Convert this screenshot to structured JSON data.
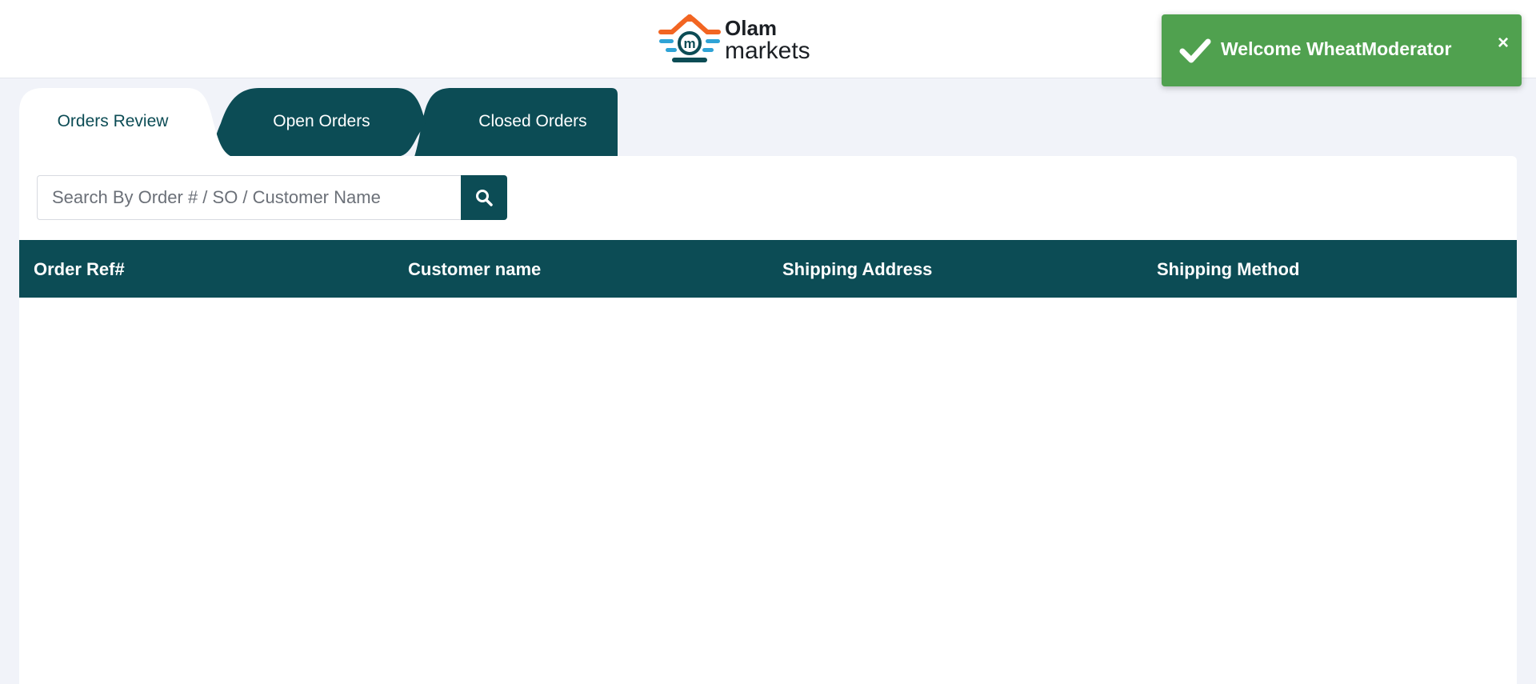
{
  "brand": {
    "name_line1": "Olam",
    "name_line2": "markets",
    "logo_letter": "m",
    "colors": {
      "orange": "#f26522",
      "blue": "#2fa3d6",
      "teal": "#0c4c55"
    }
  },
  "toast": {
    "message": "Welcome WheatModerator",
    "close_label": "×",
    "color": "#50a14f",
    "icon": "check-icon"
  },
  "tabs": [
    {
      "label": "Orders Review",
      "active": true
    },
    {
      "label": "Open Orders",
      "active": false
    },
    {
      "label": "Closed Orders",
      "active": false
    }
  ],
  "search": {
    "value": "",
    "placeholder": "Search By Order # / SO / Customer Name",
    "button_icon": "search-icon"
  },
  "table": {
    "columns": [
      "Order Ref#",
      "Customer name",
      "Shipping Address",
      "Shipping Method"
    ],
    "rows": []
  },
  "theme": {
    "primary": "#0c4c55",
    "background": "#f1f3f9",
    "success": "#50a14f"
  }
}
